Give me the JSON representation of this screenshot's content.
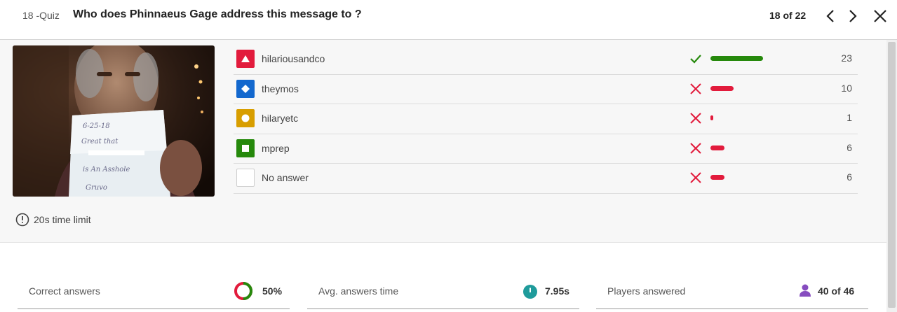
{
  "header": {
    "quiz_tag": "18 -Quiz",
    "question": "Who does Phinnaeus Gage address this message to ?",
    "counter": "18 of 22"
  },
  "media": {
    "time_limit": "20s time limit"
  },
  "answers": [
    {
      "label": "hilariousandco",
      "shape": "triangle",
      "color": "#e21b3c",
      "correct": true,
      "count": "23",
      "share": 0.5
    },
    {
      "label": "theymos",
      "shape": "diamond",
      "color": "#1368ce",
      "correct": false,
      "count": "10",
      "share": 0.22
    },
    {
      "label": "hilaryetc",
      "shape": "circle",
      "color": "#d89e00",
      "correct": false,
      "count": "1",
      "share": 0.02
    },
    {
      "label": "mprep",
      "shape": "square",
      "color": "#26890c",
      "correct": false,
      "count": "6",
      "share": 0.13
    },
    {
      "label": "No answer",
      "shape": "none",
      "color": "#ffffff",
      "correct": false,
      "count": "6",
      "share": 0.13
    }
  ],
  "colors": {
    "correct": "#26890c",
    "incorrect": "#e21b3c",
    "time_icon": "#1f9b9b",
    "player_icon": "#864cbf"
  },
  "stats": {
    "correct_label": "Correct answers",
    "correct_value": "50%",
    "correct_fraction": 0.5,
    "time_label": "Avg. answers time",
    "time_value": "7.95s",
    "players_label": "Players answered",
    "players_value": "40 of 46"
  }
}
